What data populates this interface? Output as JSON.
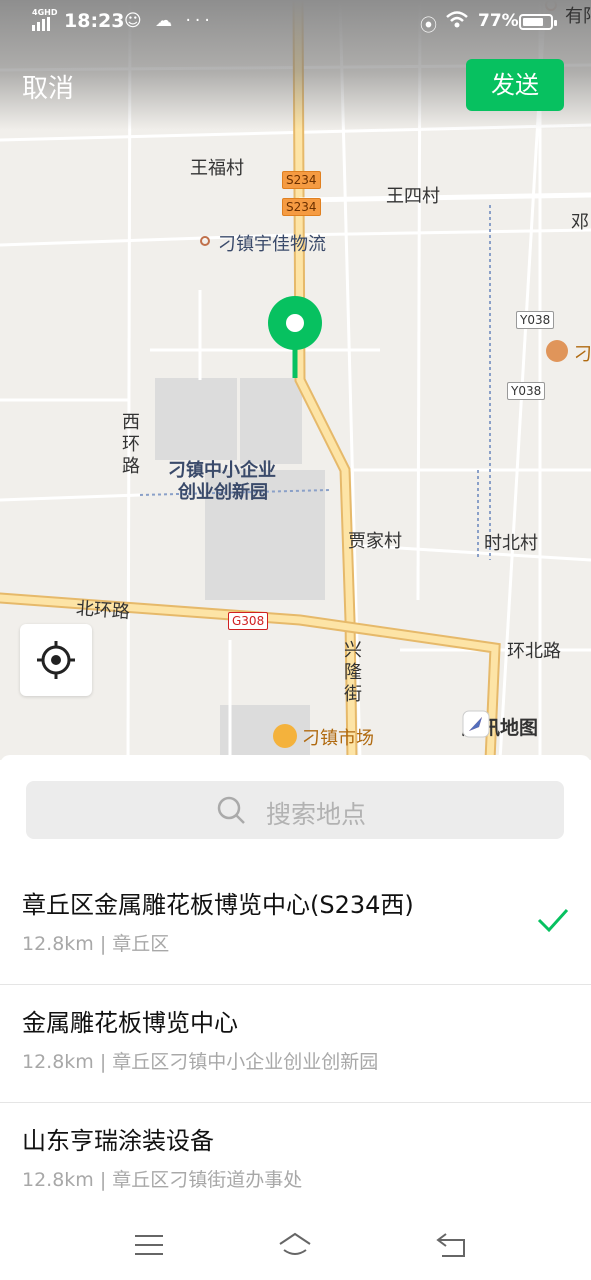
{
  "status_bar": {
    "network": "4GHD",
    "time": "18:23",
    "extra_icons": "☺ ☁ ···",
    "battery_percent": "77%",
    "battery_level": 0.77
  },
  "header": {
    "cancel_label": "取消",
    "send_label": "发送"
  },
  "map": {
    "labels": {
      "wangfu": "王福村",
      "wangsi": "王四村",
      "deng": "邓",
      "logistics": "刁镇宇佳物流",
      "xihuan": "西环路",
      "park_line1": "刁镇中小企业",
      "park_line2": "创业创新园",
      "jiajia": "贾家村",
      "shibei": "时北村",
      "beihuan": "北环路",
      "huanbei": "环北路",
      "xinglong": "兴隆街",
      "market": "刁镇市场",
      "diao_right": "刁",
      "youyang": "有阳"
    },
    "road_signs": {
      "s234_a": "S234",
      "s234_b": "S234",
      "y038_a": "Y038",
      "y038_b": "Y038",
      "g308": "G308"
    },
    "brand": "腾讯地图"
  },
  "sheet": {
    "search_placeholder": "搜索地点",
    "results": [
      {
        "title": "章丘区金属雕花板博览中心(S234西)",
        "subtitle": "12.8km | 章丘区",
        "selected": true
      },
      {
        "title": "金属雕花板博览中心",
        "subtitle": "12.8km | 章丘区刁镇中小企业创业创新园",
        "selected": false
      },
      {
        "title": "山东亨瑞涂装设备",
        "subtitle": "12.8km | 章丘区刁镇街道办事处",
        "selected": false
      }
    ]
  },
  "colors": {
    "accent": "#07c160",
    "road_major": "#fbd98c",
    "map_bg": "#f1efeb"
  }
}
